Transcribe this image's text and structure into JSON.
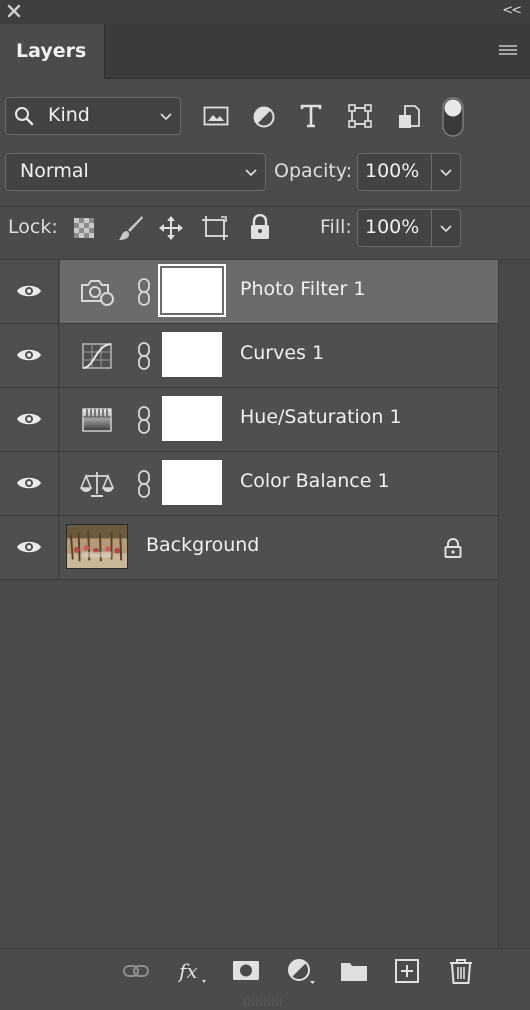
{
  "panel": {
    "title": "Layers",
    "collapse_glyph": "<<"
  },
  "filter": {
    "kind_label": "Kind",
    "icons": [
      "image-filter-icon",
      "adjustment-filter-icon",
      "type-filter-icon",
      "shape-filter-icon",
      "smart-object-filter-icon",
      "filter-toggle-switch"
    ]
  },
  "blend": {
    "mode": "Normal",
    "opacity_label": "Opacity:",
    "opacity_value": "100%"
  },
  "lock": {
    "label": "Lock:",
    "fill_label": "Fill:",
    "fill_value": "100%"
  },
  "layers": [
    {
      "name": "Photo Filter 1",
      "icon": "photo-filter-icon",
      "selected": true
    },
    {
      "name": "Curves 1",
      "icon": "curves-icon",
      "selected": false
    },
    {
      "name": "Hue/Saturation 1",
      "icon": "hue-saturation-icon",
      "selected": false
    },
    {
      "name": "Color Balance 1",
      "icon": "color-balance-icon",
      "selected": false
    },
    {
      "name": "Background",
      "icon": "image-thumbnail",
      "locked": true
    }
  ],
  "bottom_icons": [
    "link-layers-icon",
    "fx-icon",
    "add-mask-icon",
    "new-adjustment-icon",
    "new-group-icon",
    "new-layer-icon",
    "delete-icon"
  ],
  "colors": {
    "panel_bg": "#4b4b4b",
    "selected_row": "#6b6b6b",
    "text": "#f0f0f0"
  }
}
